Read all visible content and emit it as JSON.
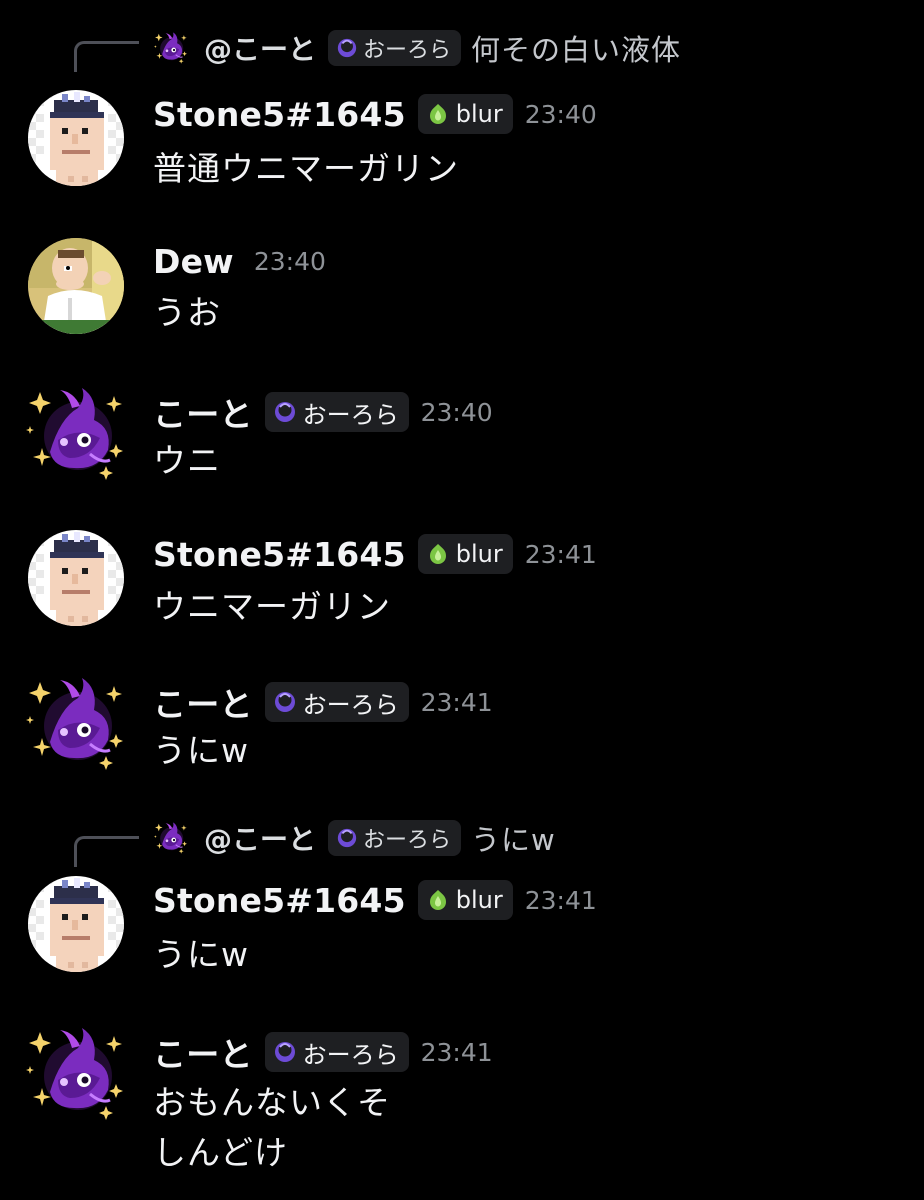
{
  "colors": {
    "background": "#000000",
    "username": "#f2f3f5",
    "timestamp": "#8e9297",
    "tag_bg": "#1e1f22",
    "reply_spine": "#4e5058",
    "aurora_icon": "#8b5cf6",
    "blur_icon": "#7cc644"
  },
  "messages": [
    {
      "reply": {
        "name": "@こーと",
        "tag": "おーろら",
        "tag_icon": "purple-swirl-icon",
        "text": "何その白い液体"
      },
      "avatar": "pixel-face-avatar",
      "username": "Stone5#1645",
      "tag": "blur",
      "tag_icon": "green-leaf-icon",
      "timestamp": "23:40",
      "lines": [
        "普通ウニマーガリン"
      ]
    },
    {
      "avatar": "cartoon-man-avatar",
      "username": "Dew",
      "timestamp": "23:40",
      "lines": [
        "うお"
      ]
    },
    {
      "avatar": "purple-creature-avatar",
      "username": "こーと",
      "tag": "おーろら",
      "tag_icon": "purple-swirl-icon",
      "timestamp": "23:40",
      "lines": [
        "ウニ"
      ]
    },
    {
      "avatar": "pixel-face-avatar",
      "username": "Stone5#1645",
      "tag": "blur",
      "tag_icon": "green-leaf-icon",
      "timestamp": "23:41",
      "lines": [
        "ウニマーガリン"
      ]
    },
    {
      "avatar": "purple-creature-avatar",
      "username": "こーと",
      "tag": "おーろら",
      "tag_icon": "purple-swirl-icon",
      "timestamp": "23:41",
      "lines": [
        "うにw"
      ]
    },
    {
      "reply": {
        "name": "@こーと",
        "tag": "おーろら",
        "tag_icon": "purple-swirl-icon",
        "text": "うにw"
      },
      "avatar": "pixel-face-avatar",
      "username": "Stone5#1645",
      "tag": "blur",
      "tag_icon": "green-leaf-icon",
      "timestamp": "23:41",
      "lines": [
        "うにw"
      ]
    },
    {
      "avatar": "purple-creature-avatar",
      "username": "こーと",
      "tag": "おーろら",
      "tag_icon": "purple-swirl-icon",
      "timestamp": "23:41",
      "lines": [
        "おもんないくそ",
        "しんどけ"
      ]
    }
  ]
}
